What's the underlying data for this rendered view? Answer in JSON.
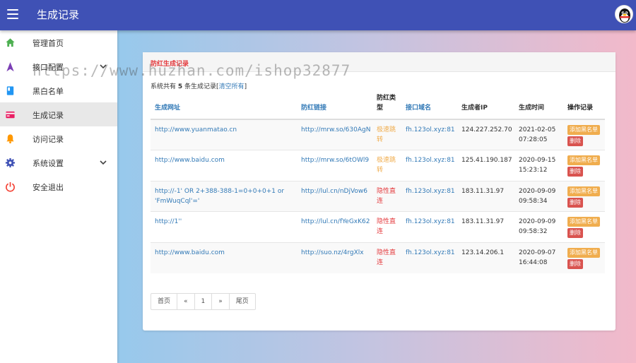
{
  "header": {
    "title": "生成记录"
  },
  "sidebar": {
    "items": [
      {
        "label": "管理首页"
      },
      {
        "label": "接口配置"
      },
      {
        "label": "黑白名单"
      },
      {
        "label": "生成记录"
      },
      {
        "label": "访问记录"
      },
      {
        "label": "系统设置"
      },
      {
        "label": "安全退出"
      }
    ]
  },
  "card": {
    "title": "防红生成记录",
    "summary_prefix": "系统共有",
    "summary_count": "5",
    "summary_suffix": "条生成记录",
    "clear_link": "清空所有"
  },
  "table": {
    "headers": [
      "生成网址",
      "防红链接",
      "防红类型",
      "接口域名",
      "生成者IP",
      "生成时间",
      "操作记录"
    ],
    "rows": [
      {
        "url": "http://www.yuanmatao.cn",
        "link": "http://mrw.so/630AgN",
        "type": "极速跳转",
        "domain": "fh.123ol.xyz:81",
        "ip": "124.227.252.70",
        "time": "2021-02-05 07:28:05"
      },
      {
        "url": "http://www.baidu.com",
        "link": "http://mrw.so/6tOWl9",
        "type": "极速跳转",
        "domain": "fh.123ol.xyz:81",
        "ip": "125.41.190.187",
        "time": "2020-09-15 15:23:12"
      },
      {
        "url": "http://-1' OR 2+388-388-1=0+0+0+1 or 'FmWuqCql'='",
        "link": "http://lul.cn/nDjVow6",
        "type": "隐性直连",
        "domain": "fh.123ol.xyz:81",
        "ip": "183.11.31.97",
        "time": "2020-09-09 09:58:34"
      },
      {
        "url": "http://1''",
        "link": "http://lul.cn/fYeGxK62",
        "type": "隐性直连",
        "domain": "fh.123ol.xyz:81",
        "ip": "183.11.31.97",
        "time": "2020-09-09 09:58:32"
      },
      {
        "url": "http://www.baidu.com",
        "link": "http://suo.nz/4rgXlx",
        "type": "隐性直连",
        "domain": "fh.123ol.xyz:81",
        "ip": "123.14.206.1",
        "time": "2020-09-07 16:44:08"
      }
    ],
    "blacklist_label": "添加黑名单",
    "delete_label": "删除"
  },
  "pagination": {
    "first": "首页",
    "prev": "«",
    "page": "1",
    "next": "»",
    "last": "尾页"
  },
  "watermark": "https://www.huzhan.com/ishop32877",
  "colors": {
    "topbar": "#3f51b5",
    "type_fast": "#f0ad4e",
    "type_hidden": "#e4393c",
    "link": "#337ab7"
  }
}
